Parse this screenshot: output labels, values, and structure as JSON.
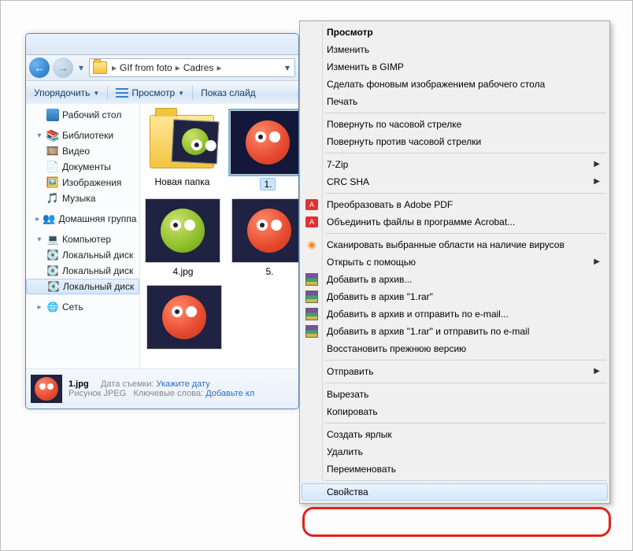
{
  "breadcrumb": {
    "seg1": "GIf from foto",
    "seg2": "Cadres"
  },
  "toolbar": {
    "organize": "Упорядочить",
    "view": "Просмотр",
    "slideshow": "Показ слайд"
  },
  "nav": {
    "desktop": "Рабочий стол",
    "libraries": "Библиотеки",
    "video": "Видео",
    "documents": "Документы",
    "pictures": "Изображения",
    "music": "Музыка",
    "homegroup": "Домашняя группа",
    "computer": "Компьютер",
    "drive1": "Локальный диск",
    "drive2": "Локальный диск",
    "drive3": "Локальный диск",
    "network": "Сеть"
  },
  "items": {
    "folder": "Новая папка",
    "sel": "1.",
    "f4": "4.jpg",
    "f5": "5."
  },
  "details": {
    "name": "1.jpg",
    "type": "Рисунок JPEG",
    "date_label": "Дата съемки:",
    "date_value": "Укажите дату",
    "keys_label": "Ключевые слова:",
    "keys_value": "Добавьте кл"
  },
  "menu": {
    "view": "Просмотр",
    "edit": "Изменить",
    "edit_gimp": "Изменить в GIMP",
    "wallpaper": "Сделать фоновым изображением рабочего стола",
    "print": "Печать",
    "rotate_cw": "Повернуть по часовой стрелке",
    "rotate_ccw": "Повернуть против часовой стрелки",
    "sevenzip": "7-Zip",
    "crc": "CRC SHA",
    "adobe_pdf": "Преобразовать в Adobe PDF",
    "acrobat_merge": "Объединить файлы в программе Acrobat...",
    "avast": "Сканировать выбранные области на наличие вирусов",
    "open_with": "Открыть с помощью",
    "rar_add": "Добавить в архив...",
    "rar_add1": "Добавить в архив \"1.rar\"",
    "rar_mail": "Добавить в архив и отправить по e-mail...",
    "rar_mail1": "Добавить в архив \"1.rar\" и отправить по e-mail",
    "prev_ver": "Восстановить прежнюю версию",
    "send_to": "Отправить",
    "cut": "Вырезать",
    "copy": "Копировать",
    "shortcut": "Создать ярлык",
    "delete": "Удалить",
    "rename": "Переименовать",
    "properties": "Свойства"
  }
}
